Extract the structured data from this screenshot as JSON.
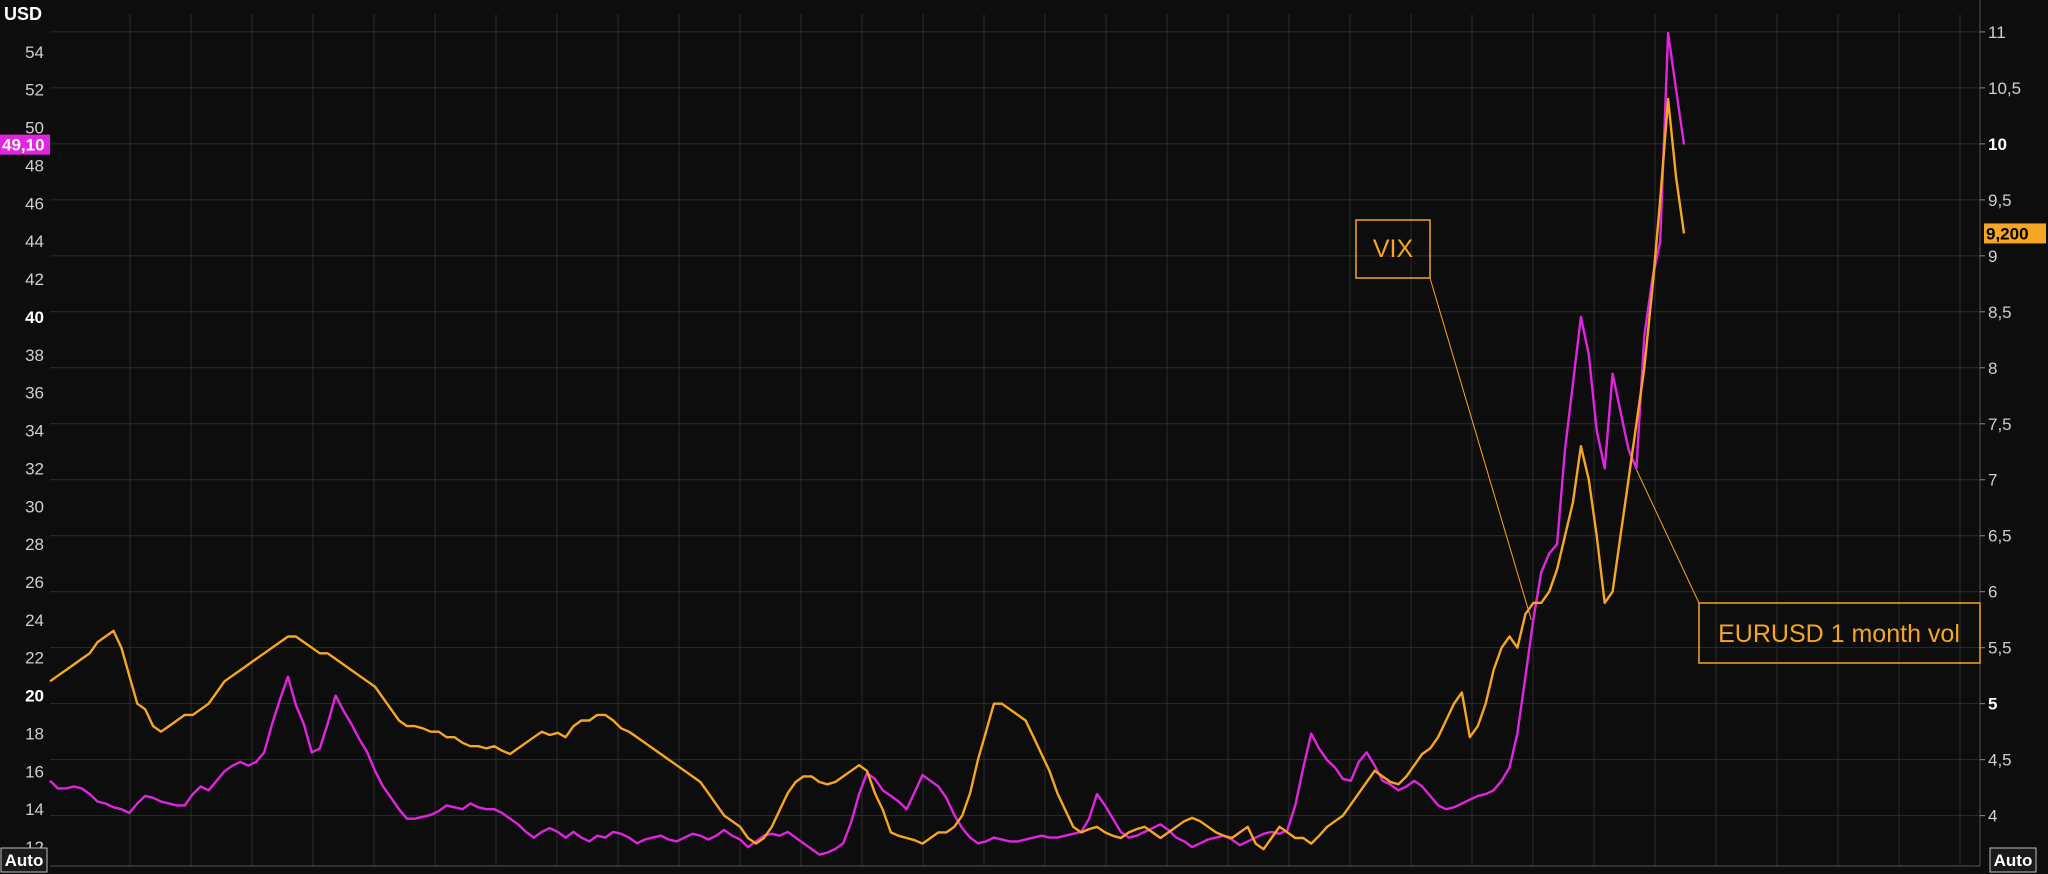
{
  "chart_data": {
    "type": "line",
    "left_axis": {
      "unit": "USD",
      "ticks": [
        12,
        14,
        16,
        18,
        20,
        22,
        24,
        26,
        28,
        30,
        32,
        34,
        36,
        38,
        40,
        42,
        44,
        46,
        48,
        50,
        52,
        54
      ],
      "bold_ticks": [
        20,
        40
      ],
      "range": [
        11,
        56
      ],
      "last_value_tag": "49,10"
    },
    "right_axis": {
      "ticks": [
        4,
        4.5,
        5,
        5.5,
        6,
        6.5,
        7,
        7.5,
        8,
        8.5,
        9,
        9.5,
        10,
        10.5,
        11
      ],
      "tick_labels": [
        "4",
        "4,5",
        "5",
        "5,5",
        "6",
        "6,5",
        "7",
        "7,5",
        "8",
        "8,5",
        "9",
        "9,5",
        "10",
        "10,5",
        "11"
      ],
      "bold_ticks": [
        5,
        10
      ],
      "range": [
        3.55,
        11.16
      ],
      "last_value_tag": "9,200"
    },
    "grid": true,
    "auto_labels": [
      "Auto",
      "Auto"
    ],
    "colors": {
      "vix": "#e024e0",
      "eurusd": "#f5a623",
      "background": "#0d0d0d",
      "grid": "#2c2c2c"
    },
    "annotations": [
      {
        "text": "VIX",
        "series": "vix"
      },
      {
        "text": "EURUSD 1 month vol",
        "series": "eurusd"
      }
    ],
    "series": [
      {
        "key": "vix",
        "axis": "left",
        "values": [
          15.5,
          15.1,
          15.1,
          15.2,
          15.1,
          14.8,
          14.4,
          14.3,
          14.1,
          14.0,
          13.8,
          14.3,
          14.7,
          14.6,
          14.4,
          14.3,
          14.2,
          14.2,
          14.8,
          15.2,
          15.0,
          15.5,
          16.0,
          16.3,
          16.5,
          16.3,
          16.5,
          17.0,
          18.5,
          19.8,
          21.0,
          19.5,
          18.5,
          17.0,
          17.2,
          18.5,
          20.0,
          19.2,
          18.5,
          17.7,
          17.0,
          16.0,
          15.2,
          14.6,
          14.0,
          13.5,
          13.5,
          13.6,
          13.7,
          13.9,
          14.2,
          14.1,
          14.0,
          14.3,
          14.1,
          14.0,
          14.0,
          13.8,
          13.5,
          13.2,
          12.8,
          12.5,
          12.8,
          13.0,
          12.8,
          12.5,
          12.8,
          12.5,
          12.3,
          12.6,
          12.5,
          12.8,
          12.7,
          12.5,
          12.2,
          12.4,
          12.5,
          12.6,
          12.4,
          12.3,
          12.5,
          12.7,
          12.6,
          12.4,
          12.6,
          12.9,
          12.6,
          12.4,
          12.0,
          12.3,
          12.6,
          12.7,
          12.6,
          12.8,
          12.5,
          12.2,
          11.9,
          11.6,
          11.7,
          11.9,
          12.2,
          13.3,
          14.8,
          15.9,
          15.6,
          15.0,
          14.7,
          14.4,
          14.0,
          14.9,
          15.8,
          15.5,
          15.2,
          14.6,
          13.7,
          13.0,
          12.5,
          12.2,
          12.3,
          12.5,
          12.4,
          12.3,
          12.3,
          12.4,
          12.5,
          12.6,
          12.5,
          12.5,
          12.6,
          12.7,
          12.8,
          13.5,
          14.8,
          14.2,
          13.5,
          12.8,
          12.5,
          12.6,
          12.8,
          13.0,
          13.2,
          12.9,
          12.5,
          12.3,
          12.0,
          12.2,
          12.4,
          12.5,
          12.6,
          12.4,
          12.1,
          12.3,
          12.5,
          12.7,
          12.8,
          12.7,
          12.9,
          14.2,
          16.2,
          18.0,
          17.2,
          16.6,
          16.2,
          15.6,
          15.5,
          16.5,
          17.0,
          16.3,
          15.5,
          15.3,
          15.0,
          15.2,
          15.5,
          15.2,
          14.7,
          14.2,
          14.0,
          14.1,
          14.3,
          14.5,
          14.7,
          14.8,
          15.0,
          15.5,
          16.2,
          18.0,
          21.0,
          24.0,
          26.5,
          27.5,
          28.0,
          33.0,
          36.5,
          40.0,
          38.0,
          34.0,
          32.0,
          37.0,
          35.0,
          33.0,
          32.0,
          39.0,
          42.0,
          44.0,
          55.0,
          52.0,
          49.1
        ]
      },
      {
        "key": "eurusd",
        "axis": "right",
        "values": [
          5.2,
          5.25,
          5.3,
          5.35,
          5.4,
          5.45,
          5.55,
          5.6,
          5.65,
          5.5,
          5.25,
          5.0,
          4.95,
          4.8,
          4.75,
          4.8,
          4.85,
          4.9,
          4.9,
          4.95,
          5.0,
          5.1,
          5.2,
          5.25,
          5.3,
          5.35,
          5.4,
          5.45,
          5.5,
          5.55,
          5.6,
          5.6,
          5.55,
          5.5,
          5.45,
          5.45,
          5.4,
          5.35,
          5.3,
          5.25,
          5.2,
          5.15,
          5.05,
          4.95,
          4.85,
          4.8,
          4.8,
          4.78,
          4.75,
          4.75,
          4.7,
          4.7,
          4.65,
          4.62,
          4.62,
          4.6,
          4.62,
          4.58,
          4.55,
          4.6,
          4.65,
          4.7,
          4.75,
          4.72,
          4.74,
          4.7,
          4.8,
          4.85,
          4.85,
          4.9,
          4.9,
          4.85,
          4.78,
          4.75,
          4.7,
          4.65,
          4.6,
          4.55,
          4.5,
          4.45,
          4.4,
          4.35,
          4.3,
          4.2,
          4.1,
          4.0,
          3.95,
          3.9,
          3.8,
          3.75,
          3.8,
          3.9,
          4.05,
          4.2,
          4.3,
          4.35,
          4.35,
          4.3,
          4.28,
          4.3,
          4.35,
          4.4,
          4.45,
          4.4,
          4.2,
          4.05,
          3.85,
          3.82,
          3.8,
          3.78,
          3.75,
          3.8,
          3.85,
          3.85,
          3.9,
          4.0,
          4.2,
          4.5,
          4.75,
          5.0,
          5.0,
          4.95,
          4.9,
          4.85,
          4.7,
          4.55,
          4.4,
          4.2,
          4.05,
          3.9,
          3.85,
          3.88,
          3.9,
          3.85,
          3.82,
          3.8,
          3.85,
          3.88,
          3.9,
          3.85,
          3.8,
          3.85,
          3.9,
          3.95,
          3.98,
          3.95,
          3.9,
          3.85,
          3.82,
          3.8,
          3.85,
          3.9,
          3.75,
          3.7,
          3.8,
          3.9,
          3.85,
          3.8,
          3.8,
          3.75,
          3.82,
          3.9,
          3.95,
          4.0,
          4.1,
          4.2,
          4.3,
          4.4,
          4.35,
          4.3,
          4.28,
          4.35,
          4.45,
          4.55,
          4.6,
          4.7,
          4.85,
          5.0,
          5.1,
          4.7,
          4.8,
          5.0,
          5.3,
          5.5,
          5.6,
          5.5,
          5.8,
          5.9,
          5.9,
          6.0,
          6.2,
          6.5,
          6.8,
          7.3,
          7.0,
          6.5,
          5.9,
          6.0,
          6.5,
          7.0,
          7.5,
          8.0,
          8.7,
          9.5,
          10.4,
          9.7,
          9.2
        ]
      }
    ]
  }
}
